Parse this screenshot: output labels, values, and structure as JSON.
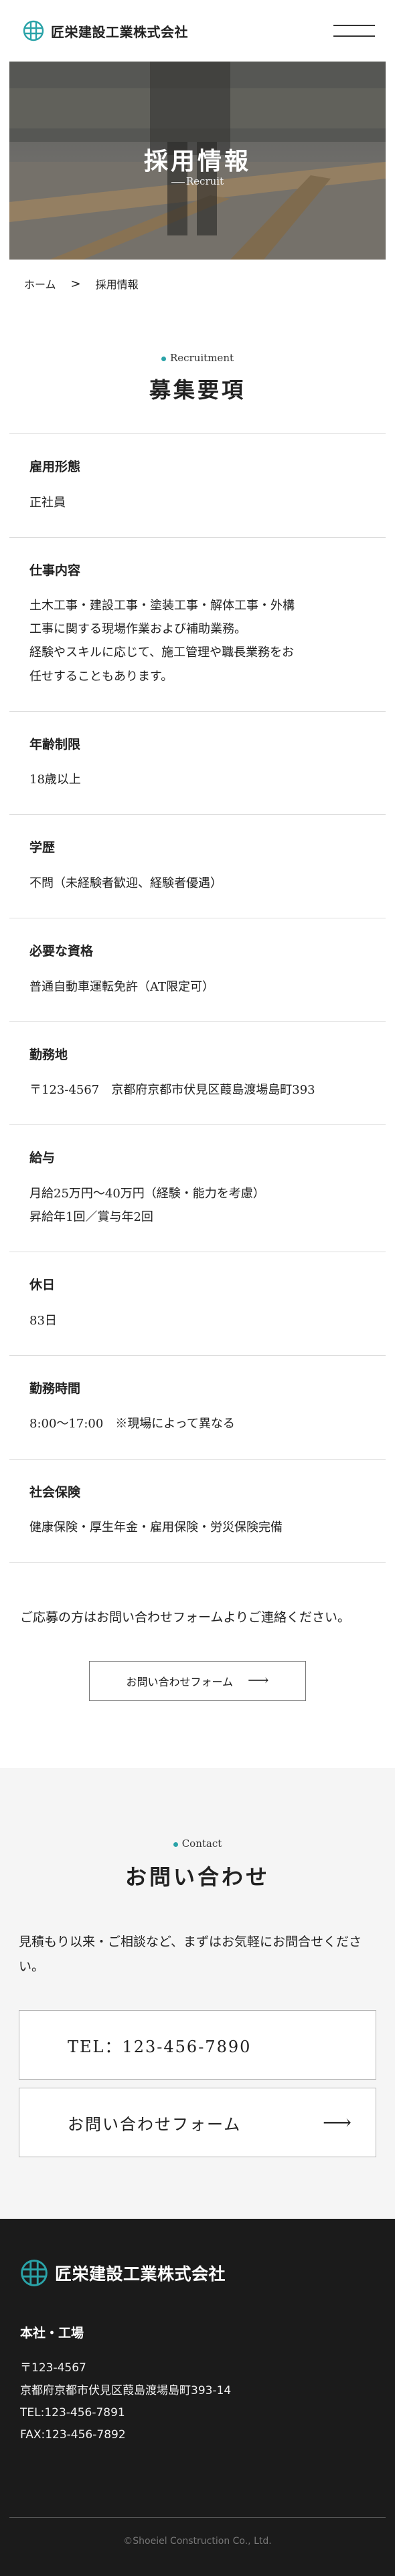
{
  "header": {
    "company_name": "匠栄建設工業株式会社",
    "brand_color": "#2aa3a8",
    "menu_icon": "hamburger-icon"
  },
  "hero": {
    "title": "採用情報",
    "subtitle": "Recruit"
  },
  "breadcrumb": {
    "home": "ホーム",
    "separator": ">",
    "current": "採用情報"
  },
  "recruitment": {
    "label": "Recruitment",
    "title": "募集要項",
    "items": [
      {
        "label": "雇用形態",
        "value": "正社員"
      },
      {
        "label": "仕事内容",
        "value": "土木工事・建設工事・塗装工事・解体工事・外構\n工事に関する現場作業および補助業務。\n経験やスキルに応じて、施工管理や職長業務をお\n任せすることもあります。"
      },
      {
        "label": "年齢制限",
        "value": "18歳以上"
      },
      {
        "label": "学歴",
        "value": "不問（未経験者歓迎、経験者優遇）"
      },
      {
        "label": "必要な資格",
        "value": "普通自動車運転免許（AT限定可）"
      },
      {
        "label": "勤務地",
        "value": "〒123-4567　京都府京都市伏見区葭島渡場島町393"
      },
      {
        "label": "給与",
        "value": "月給25万円〜40万円（経験・能力を考慮）\n昇給年1回／賞与年2回"
      },
      {
        "label": "休日",
        "value": "83日"
      },
      {
        "label": "勤務時間",
        "value": "8:00〜17:00　※現場によって異なる"
      },
      {
        "label": "社会保険",
        "value": "健康保険・厚生年金・雇用保険・労災保険完備"
      }
    ],
    "apply_note": "ご応募の方はお問い合わせフォームよりご連絡ください。",
    "apply_button": "お問い合わせフォーム"
  },
  "contact": {
    "label": "Contact",
    "title": "お問い合わせ",
    "text": "見積もり以来・ご相談など、まずはお気軽にお問合せください。",
    "tel": "TEL：123-456-7890",
    "form_button": "お問い合わせフォーム"
  },
  "footer": {
    "company_name": "匠栄建設工業株式会社",
    "office": "本社・工場",
    "postal": "〒123-4567",
    "address": "京都府京都市伏見区葭島渡場島町393-14",
    "tel": "TEL:123-456-7891",
    "fax": "FAX:123-456-7892",
    "copyright": "©Shoeiel Construction Co., Ltd."
  }
}
